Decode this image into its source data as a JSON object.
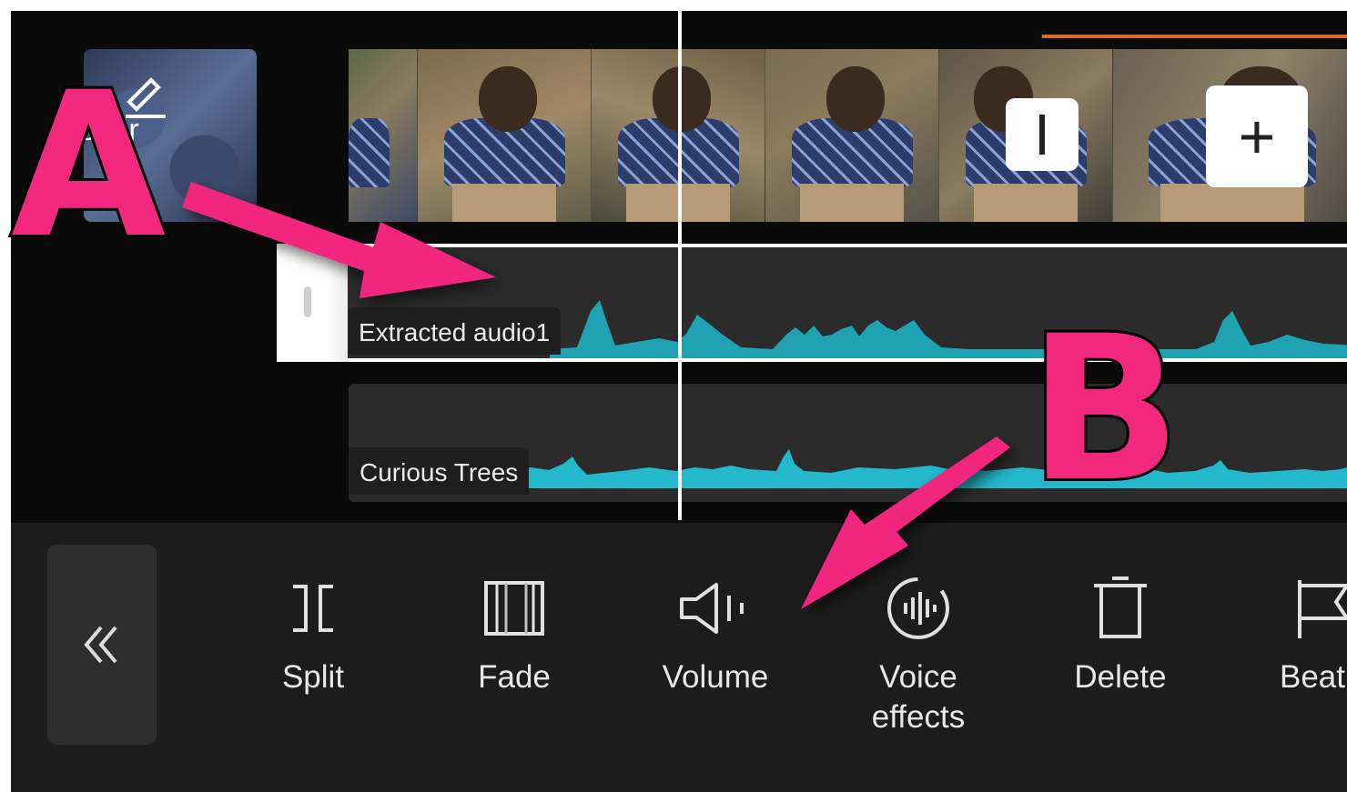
{
  "cover": {
    "label": "Cover",
    "icon": "pencil-icon"
  },
  "video_strip": {
    "frame_count": 6,
    "split_button_icon": "split-marker-icon",
    "add_button_label": "+",
    "trim_marker_color": "#e0663a"
  },
  "audio_tracks": [
    {
      "label": "Extracted audio1",
      "selected": true,
      "waveform_color": "#1fa3b3"
    },
    {
      "label": "Curious Trees",
      "selected": false,
      "waveform_color": "#23b8cc"
    }
  ],
  "toolbar": {
    "collapse_icon": "double-chevron-left-icon",
    "tools": [
      {
        "label": "Split",
        "icon": "split-icon"
      },
      {
        "label": "Fade",
        "icon": "fade-icon"
      },
      {
        "label": "Volume",
        "icon": "volume-icon"
      },
      {
        "label": "Voice\neffects",
        "icon": "voice-effects-icon"
      },
      {
        "label": "Delete",
        "icon": "delete-icon"
      },
      {
        "label": "Beat",
        "icon": "beat-flag-icon"
      }
    ]
  },
  "annotations": {
    "a_label": "A",
    "b_label": "B",
    "color": "#f2287f"
  }
}
